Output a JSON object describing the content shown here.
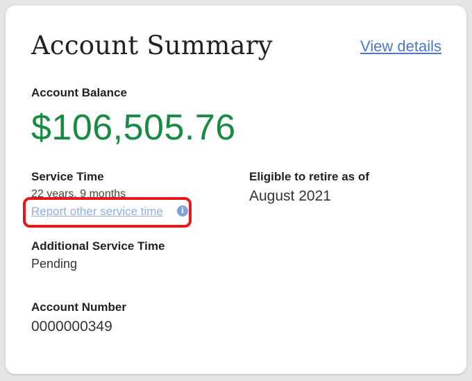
{
  "card": {
    "title": "Account Summary",
    "view_details_label": "View details"
  },
  "balance": {
    "label": "Account Balance",
    "amount": "$106,505.76",
    "color": "#178a43"
  },
  "service_time": {
    "label": "Service Time",
    "value": "22 years, 9 months",
    "report_link_label": "Report other service time",
    "info_icon": "info-icon"
  },
  "eligible": {
    "label": "Eligible to retire as of",
    "value": "August 2021"
  },
  "additional_service": {
    "label": "Additional Service Time",
    "value": "Pending"
  },
  "account_number": {
    "label": "Account Number",
    "value": "0000000349"
  },
  "colors": {
    "link": "#4a78c2",
    "highlight": "#e41a1a"
  }
}
